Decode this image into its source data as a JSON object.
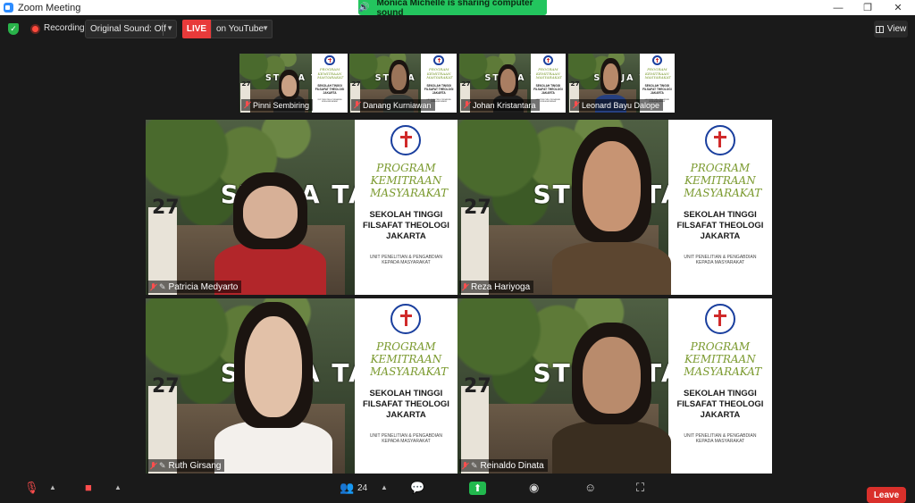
{
  "window": {
    "title": "Zoom Meeting",
    "minimize": "—",
    "restore": "❐",
    "close": "✕"
  },
  "banner": {
    "text": "Monica Michelle is sharing computer sound"
  },
  "toolbar": {
    "recording": "Recording",
    "original_sound": "Original Sound: Off",
    "live": "LIVE",
    "live_destination": "on YouTube",
    "view": "View"
  },
  "backdrop": {
    "stt": "STT JA   TA",
    "number": "27",
    "program": "PROGRAM KEMITRAAN MASYARAKAT",
    "school": "SEKOLAH TINGGI FILSAFAT THEOLOGI JAKARTA",
    "unit": "UNIT PENELITIAN & PENGABDIAN KEPADA MASYARAKAT"
  },
  "top_strip": [
    {
      "name": "Pinni Sembiring"
    },
    {
      "name": "Danang Kurniawan"
    },
    {
      "name": "Johan Kristantara"
    },
    {
      "name": "Leonard Bayu Dalope"
    }
  ],
  "gallery": [
    {
      "name": "Patricia Medyarto"
    },
    {
      "name": "Reza Hariyoga"
    },
    {
      "name": "Ruth Girsang"
    },
    {
      "name": "Reinaldo Dinata"
    }
  ],
  "bottom": {
    "participants_count": "24",
    "leave": "Leave"
  },
  "colors": {
    "active_speaker_border": "#c8e94a",
    "live_red": "#e83a3a",
    "banner_green": "#23c55e",
    "leave_red": "#d9302b"
  }
}
